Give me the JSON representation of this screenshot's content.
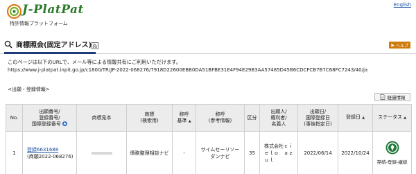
{
  "header": {
    "logo_text": "J-PlatPat",
    "logo_subtitle": "特許情報プラットフォーム",
    "english_link": "English"
  },
  "title_bar": {
    "title": "商標照会(固定アドレス)",
    "help_label": "ヘルプ"
  },
  "info": {
    "line1": "このページは以下のURLで、メール等による情報共有にご利用いただけます。",
    "url": "https://www.j-platpat.inpit.go.jp/c1800/TR/JP-2022-068276/7918D22600EBB0DA51BFBE31E4F94E29B3AA57485D45B6CDCFCB7B7C68FC7243/40/ja"
  },
  "section_label": "<出願・登録情報>",
  "history_button": "経過情報",
  "table": {
    "headers": {
      "no": "No.",
      "app_no_l1": "出願番号/",
      "app_no_l2": "登録番号/",
      "app_no_l3": "国際登録番号",
      "mark_image": "商標見本",
      "mark_search_l1": "商標",
      "mark_search_l2": "(検索用)",
      "yobi_base_l1": "称呼",
      "yobi_base_l2": "基準",
      "yobi_ref_l1": "称呼",
      "yobi_ref_l2": "(参考情報)",
      "class": "区分",
      "applicant_l1": "出願人/",
      "applicant_l2": "権利者/",
      "applicant_l3": "名義人",
      "app_date_l1": "出願日/",
      "app_date_l2": "国際登録日",
      "app_date_l3": "(事後指定日)",
      "reg_date": "登録日",
      "status": "ステータス"
    },
    "rows": [
      {
        "no": "1",
        "reg_no": "登録6631688",
        "app_no": "(商願2022-068276)",
        "mark_search": "債務整理相談ナビ",
        "yobi_base": "-",
        "yobi_ref_l1": "サイムセーリソー",
        "yobi_ref_l2": "ダンナビ",
        "class": "35",
        "applicant_l1": "株式会社ｃｉ",
        "applicant_l2": "ｅｌｏ　ａｚ",
        "applicant_l3": "ｕｌ",
        "app_date": "2022/06/14",
        "reg_date": "2022/10/24",
        "status": "存続-登録-継続"
      }
    ]
  }
}
